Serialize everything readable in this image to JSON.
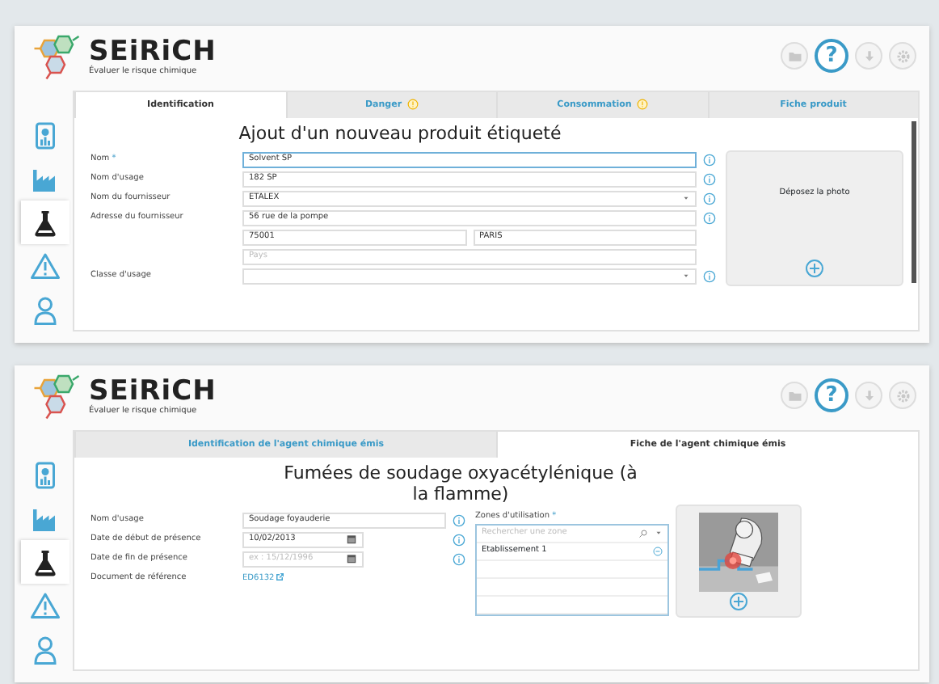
{
  "screens": [
    {
      "brand": "SEiRiCH",
      "tagline": "Évaluer le risque chimique",
      "header_buttons": [
        {
          "kind": "folder",
          "highlighted": false
        },
        {
          "kind": "help",
          "label": "?",
          "highlighted": true
        },
        {
          "kind": "download",
          "highlighted": false
        },
        {
          "kind": "settings",
          "highlighted": false
        }
      ],
      "sidebar": [
        {
          "kind": "dashboard",
          "selected": false
        },
        {
          "kind": "factory",
          "selected": false
        },
        {
          "kind": "flask",
          "selected": true
        },
        {
          "kind": "warning",
          "selected": false
        },
        {
          "kind": "person",
          "selected": false
        }
      ],
      "tabs": [
        {
          "label": "Identification",
          "selected": true,
          "warning": false
        },
        {
          "label": "Danger",
          "selected": false,
          "warning": true
        },
        {
          "label": "Consommation",
          "selected": false,
          "warning": true
        },
        {
          "label": "Fiche produit",
          "selected": false,
          "warning": false
        }
      ],
      "title": "Ajout d'un nouveau produit étiqueté",
      "fields": [
        {
          "label": "Nom",
          "required_mark": "*",
          "info": true,
          "inputs": [
            {
              "kind": "text",
              "value": "Solvent SP",
              "focused": true
            }
          ]
        },
        {
          "label": "Nom d'usage",
          "info": true,
          "inputs": [
            {
              "kind": "text",
              "value": "182 SP",
              "focused": false
            }
          ]
        },
        {
          "label": "Nom du fournisseur",
          "info": true,
          "inputs": [
            {
              "kind": "select",
              "value": "ETALEX",
              "focused": false
            }
          ]
        },
        {
          "label": "Adresse du fournisseur",
          "info": true,
          "inputs": [
            {
              "kind": "text",
              "value": "56 rue de la pompe",
              "focused": false
            }
          ]
        },
        {
          "info": false,
          "inputs": [
            {
              "kind": "text",
              "value": "75001",
              "focused": false
            },
            {
              "kind": "text",
              "value": "PARIS",
              "focused": false
            }
          ]
        },
        {
          "info": false,
          "inputs": [
            {
              "kind": "text",
              "placeholder": "Pays",
              "focused": false
            }
          ]
        },
        {
          "label": "Classe d'usage",
          "info": true,
          "inputs": [
            {
              "kind": "select",
              "focused": false
            }
          ]
        }
      ],
      "photo": {
        "kind": "dropzone",
        "text": "Déposez la photo"
      }
    },
    {
      "brand": "SEiRiCH",
      "tagline": "Évaluer le risque chimique",
      "header_buttons": [
        {
          "kind": "folder",
          "highlighted": false
        },
        {
          "kind": "help",
          "label": "?",
          "highlighted": true
        },
        {
          "kind": "download",
          "highlighted": false
        },
        {
          "kind": "settings",
          "highlighted": false
        }
      ],
      "sidebar": [
        {
          "kind": "dashboard",
          "selected": false
        },
        {
          "kind": "factory",
          "selected": false
        },
        {
          "kind": "flask",
          "selected": true
        },
        {
          "kind": "warning",
          "selected": false
        },
        {
          "kind": "person",
          "selected": false
        }
      ],
      "tabs": [
        {
          "label": "Identification de l'agent chimique émis",
          "selected": false,
          "warning": false
        },
        {
          "label": "Fiche de l'agent chimique émis",
          "selected": true,
          "warning": false
        }
      ],
      "title": "Fumées de soudage oxyacétylénique (à la flamme)",
      "fields": [
        {
          "label": "Nom d'usage",
          "info": true,
          "inputs": [
            {
              "kind": "text",
              "value": "Soudage foyauderie",
              "focused": false
            }
          ]
        },
        {
          "label": "Date de début de présence",
          "info": true,
          "inputs": [
            {
              "kind": "date",
              "value": "10/02/2013",
              "focused": false
            }
          ]
        },
        {
          "label": "Date de fin de présence",
          "info": true,
          "inputs": [
            {
              "kind": "date",
              "placeholder": "ex : 15/12/1996",
              "focused": false
            }
          ]
        },
        {
          "label": "Document de référence",
          "info": false,
          "inputs": [
            {
              "kind": "link",
              "value": "ED6132"
            }
          ]
        }
      ],
      "zones": {
        "label": "Zones d'utilisation",
        "required_mark": "*",
        "placeholder": "Rechercher une zone",
        "items": [
          "Etablissement 1"
        ]
      },
      "photo": {
        "kind": "picture"
      }
    }
  ]
}
